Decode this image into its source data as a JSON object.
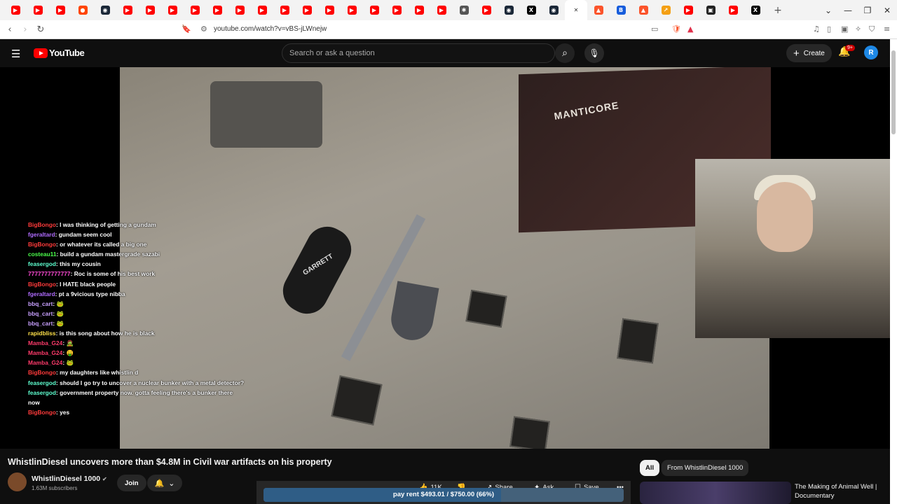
{
  "browser": {
    "tab_favicons": [
      {
        "icon": "youtube-icon",
        "color": "#ff0000"
      },
      {
        "icon": "youtube-icon",
        "color": "#ff0000"
      },
      {
        "icon": "youtube-icon",
        "color": "#ff0000"
      },
      {
        "icon": "reddit-icon",
        "color": "#ff4500"
      },
      {
        "icon": "steam-icon",
        "color": "#1b2838"
      },
      {
        "icon": "youtube-icon",
        "color": "#ff0000"
      },
      {
        "icon": "youtube-icon",
        "color": "#ff0000"
      },
      {
        "icon": "youtube-icon",
        "color": "#ff0000"
      },
      {
        "icon": "youtube-icon",
        "color": "#ff0000"
      },
      {
        "icon": "youtube-icon",
        "color": "#ff0000"
      },
      {
        "icon": "youtube-icon",
        "color": "#ff0000"
      },
      {
        "icon": "youtube-icon",
        "color": "#ff0000"
      },
      {
        "icon": "youtube-icon",
        "color": "#ff0000"
      },
      {
        "icon": "youtube-icon",
        "color": "#ff0000"
      },
      {
        "icon": "youtube-icon",
        "color": "#ff0000"
      },
      {
        "icon": "youtube-icon",
        "color": "#ff0000"
      },
      {
        "icon": "youtube-icon",
        "color": "#ff0000"
      },
      {
        "icon": "youtube-icon",
        "color": "#ff0000"
      },
      {
        "icon": "youtube-icon",
        "color": "#ff0000"
      },
      {
        "icon": "youtube-icon",
        "color": "#ff0000"
      },
      {
        "icon": "settings-icon",
        "color": "#555555"
      },
      {
        "icon": "youtube-icon",
        "color": "#ff0000"
      },
      {
        "icon": "steam-icon",
        "color": "#1b2838"
      },
      {
        "icon": "x-icon",
        "color": "#000000"
      },
      {
        "icon": "steam-icon",
        "color": "#1b2838"
      },
      {
        "icon": "close-icon",
        "color": "#333333"
      },
      {
        "icon": "brave-icon",
        "color": "#fb542b"
      },
      {
        "icon": "bitwarden-icon",
        "color": "#175ddc"
      },
      {
        "icon": "brave-icon",
        "color": "#fb542b"
      },
      {
        "icon": "chart-icon",
        "color": "#f4a015"
      },
      {
        "icon": "youtube-icon",
        "color": "#ff0000"
      },
      {
        "icon": "media-icon",
        "color": "#222222"
      },
      {
        "icon": "youtube-icon",
        "color": "#ff0000"
      },
      {
        "icon": "x-icon",
        "color": "#000000"
      }
    ],
    "new_tab": "+",
    "url": "youtube.com/watch?v=vBS-jLWnejw"
  },
  "youtube": {
    "logo_text": "YouTube",
    "search_placeholder": "Search or ask a question",
    "create_label": "Create",
    "notif_badge": "9+",
    "avatar_letter": "R"
  },
  "video_overlay": {
    "box_brand": "MANTICORE",
    "sheath_brand": "GARRETT"
  },
  "chat": [
    {
      "user": "BigBongo",
      "color": "#ff3b3b",
      "msg": "I was thinking of getting a gundam"
    },
    {
      "user": "fgeraltard",
      "color": "#b06cff",
      "msg": "gundam seem cool"
    },
    {
      "user": "BigBongo",
      "color": "#ff3b3b",
      "msg": "or whatever its called a big one"
    },
    {
      "user": "costeau11",
      "color": "#4cff4c",
      "msg": "build a gundam mastergrade sazabi"
    },
    {
      "user": "feasergod",
      "color": "#5fffd0",
      "msg": "this my cousin"
    },
    {
      "user": "7777777777777",
      "color": "#ff4ad6",
      "msg": "Roc is some of his best work"
    },
    {
      "user": "BigBongo",
      "color": "#ff3b3b",
      "msg": "I HATE black people"
    },
    {
      "user": "fgeraltard",
      "color": "#b06cff",
      "msg": "pt a 9vicious type nibba"
    },
    {
      "user": "bbq_cart",
      "color": "#c8a0ff",
      "msg": "🐸"
    },
    {
      "user": "bbq_cart",
      "color": "#c8a0ff",
      "msg": "🐸"
    },
    {
      "user": "bbq_cart",
      "color": "#c8a0ff",
      "msg": "🐸"
    },
    {
      "user": "rapidbliss",
      "color": "#ffe14a",
      "msg": "is this song about how he is black"
    },
    {
      "user": "Mamba_G24",
      "color": "#ff3b6b",
      "msg": "🧟"
    },
    {
      "user": "Mamba_G24",
      "color": "#ff3b6b",
      "msg": "🤑"
    },
    {
      "user": "Mamba_G24",
      "color": "#ff3b6b",
      "msg": "🐸"
    },
    {
      "user": "BigBongo",
      "color": "#ff3b3b",
      "msg": "my daughters like whistlin d"
    },
    {
      "user": "feasergod",
      "color": "#5fffd0",
      "msg": "should I go try to uncover a nuclear bunker with a metal detector?"
    },
    {
      "user": "feasergod",
      "color": "#5fffd0",
      "msg": "government property now. gotta feeling there's a bunker there"
    },
    {
      "user": "",
      "color": "#ffffff",
      "msg": "now"
    },
    {
      "user": "BigBongo",
      "color": "#ff3b3b",
      "msg": "yes"
    }
  ],
  "video": {
    "title": "WhistlinDiesel uncovers more than $4.8M in Civil war artifacts on his property",
    "channel": "WhistlinDiesel 1000",
    "verified": "✔",
    "subscribers": "1.63M subscribers",
    "join": "Join",
    "like_count": "11K",
    "share": "Share",
    "ask": "Ask",
    "save": "Save",
    "more": "•••",
    "goal_text": "pay rent $493.01 / $750.00 (66%)",
    "goal_progress": 0.66
  },
  "sidebar": {
    "chips": [
      "All",
      "From WhistlinDiesel 1000"
    ],
    "rec_title": "The Making of Animal Well | Documentary"
  }
}
